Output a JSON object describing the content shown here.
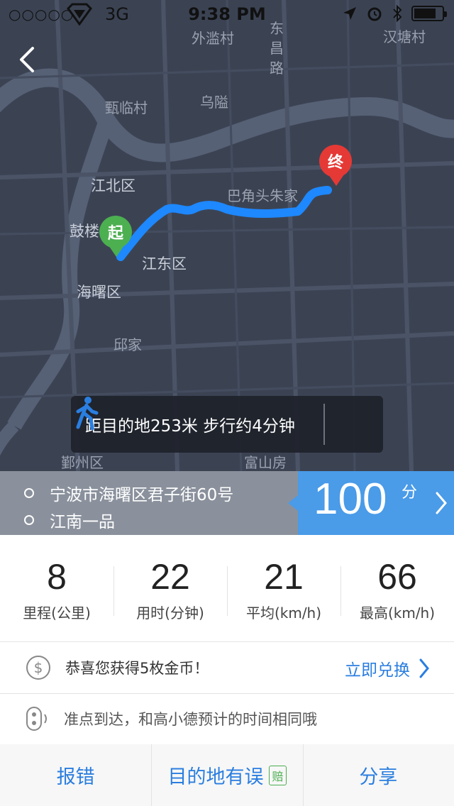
{
  "status_bar": {
    "signal": "○○○○○",
    "network": "3G",
    "time": "9:38 PM"
  },
  "map": {
    "labels": {
      "gulou": "鼓楼",
      "jiangbei": "江北区",
      "jiangdong": "江东区",
      "haishu": "海曙区",
      "zhenlin": "甄临村",
      "wailan": "外滥村",
      "wulin": "乌隘",
      "dongchang": "东昌路",
      "hantang": "汉塘村",
      "bajiao": "巴角头朱家",
      "qiujia": "邱家",
      "fuzhou": "鄞州区",
      "fushan": "富山房"
    },
    "start_pin": "起",
    "end_pin": "终"
  },
  "tip": {
    "text": "距目的地253米 步行约4分钟"
  },
  "route": {
    "origin": "宁波市海曙区君子街60号",
    "destination": "江南一品"
  },
  "score": {
    "value": "100",
    "unit": "分"
  },
  "stats": [
    {
      "value": "8",
      "label": "里程(公里)"
    },
    {
      "value": "22",
      "label": "用时(分钟)"
    },
    {
      "value": "21",
      "label": "平均(km/h)"
    },
    {
      "value": "66",
      "label": "最高(km/h)"
    }
  ],
  "coins": {
    "message": "恭喜您获得5枚金币！",
    "action": "立即兑换"
  },
  "punctuality": {
    "message": "准点到达，和高小德预计的时间相同哦"
  },
  "footer": {
    "report": "报错",
    "dest_wrong": "目的地有误",
    "dest_badge": "赔",
    "share": "分享"
  },
  "colors": {
    "accent": "#2a7ee0",
    "score_bg": "#4a9be8",
    "route_line": "#1e88ff",
    "start_pin": "#4caf50",
    "end_pin": "#e53935"
  }
}
